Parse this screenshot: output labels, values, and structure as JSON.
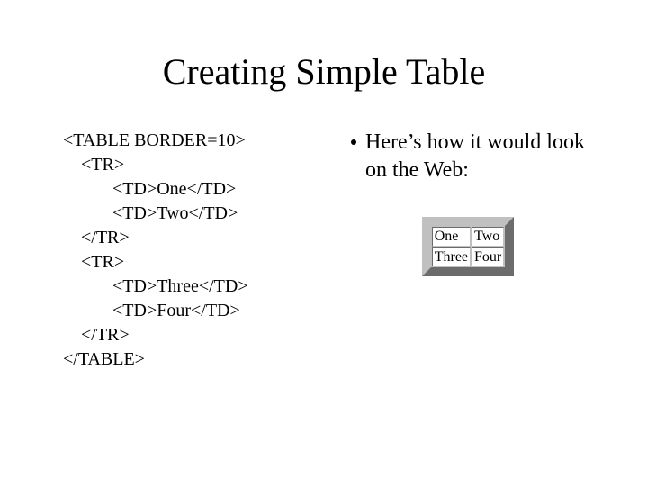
{
  "slide": {
    "title": "Creating Simple Table",
    "code_lines": [
      "<TABLE BORDER=10>",
      "    <TR>",
      "           <TD>One</TD>",
      "           <TD>Two</TD>",
      "    </TR>",
      "    <TR>",
      "           <TD>Three</TD>",
      "           <TD>Four</TD>",
      "    </TR>",
      "</TABLE>"
    ],
    "bullet_text": "Here’s how it would look on the Web:"
  },
  "chart_data": {
    "type": "table",
    "rows": [
      [
        "One",
        "Two"
      ],
      [
        "Three",
        "Four"
      ]
    ]
  }
}
